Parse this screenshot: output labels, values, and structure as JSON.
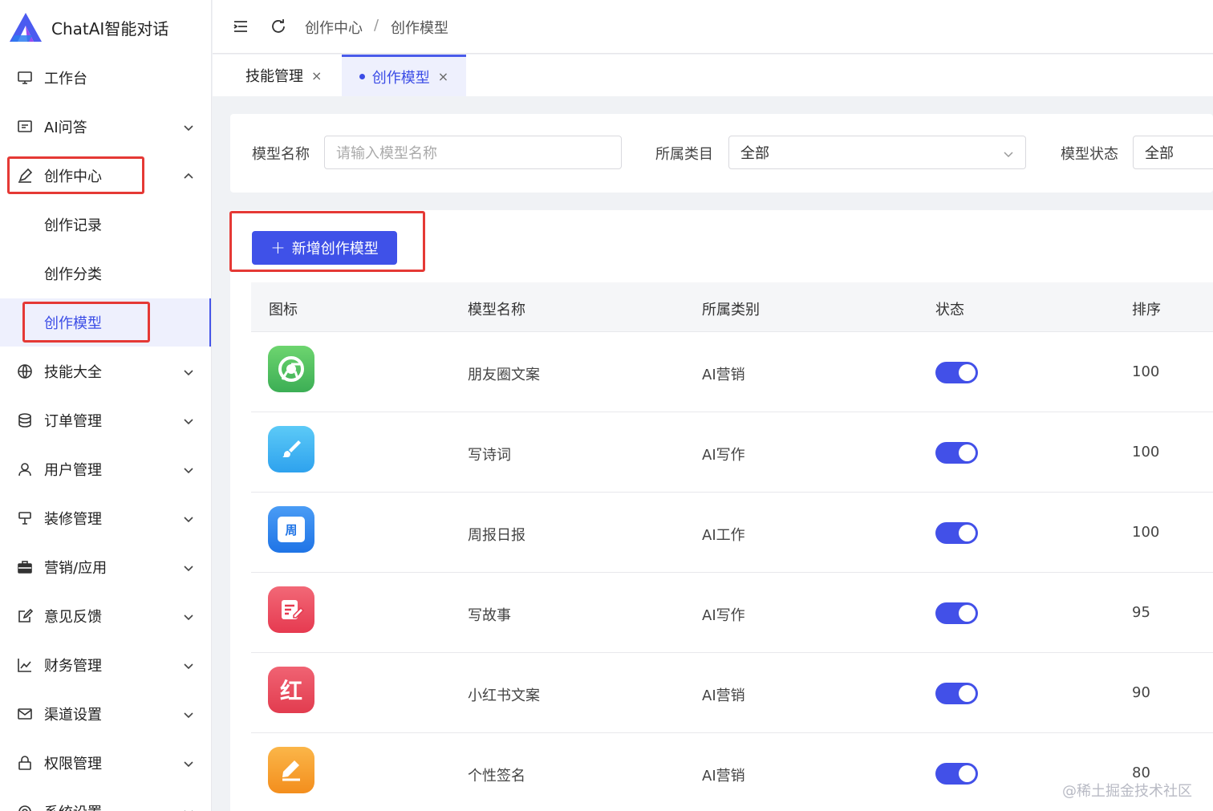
{
  "app": {
    "title": "ChatAI智能对话"
  },
  "sidebar": {
    "items": [
      {
        "label": "工作台",
        "icon": "monitor-icon"
      },
      {
        "label": "AI问答",
        "icon": "message-icon"
      },
      {
        "label": "创作中心",
        "icon": "edit-pen-icon"
      },
      {
        "label": "创作记录"
      },
      {
        "label": "创作分类"
      },
      {
        "label": "创作模型"
      },
      {
        "label": "技能大全",
        "icon": "globe-icon"
      },
      {
        "label": "订单管理",
        "icon": "database-icon"
      },
      {
        "label": "用户管理",
        "icon": "user-icon"
      },
      {
        "label": "装修管理",
        "icon": "brush-icon"
      },
      {
        "label": "营销/应用",
        "icon": "briefcase-icon"
      },
      {
        "label": "意见反馈",
        "icon": "feedback-icon"
      },
      {
        "label": "财务管理",
        "icon": "chart-icon"
      },
      {
        "label": "渠道设置",
        "icon": "mail-icon"
      },
      {
        "label": "权限管理",
        "icon": "lock-icon"
      },
      {
        "label": "系统设置",
        "icon": "settings-icon"
      }
    ]
  },
  "header": {
    "breadcrumb": [
      "创作中心",
      "创作模型"
    ],
    "separator": "/"
  },
  "tabs": [
    {
      "label": "技能管理",
      "close": "×"
    },
    {
      "label": "创作模型",
      "close": "×"
    }
  ],
  "filters": {
    "name_label": "模型名称",
    "name_placeholder": "请输入模型名称",
    "category_label": "所属类目",
    "category_value": "全部",
    "status_label": "模型状态",
    "status_value": "全部"
  },
  "toolbar": {
    "add_label": "新增创作模型",
    "add_icon": "+"
  },
  "table": {
    "headers": [
      "图标",
      "模型名称",
      "所属类别",
      "状态",
      "排序"
    ],
    "rows": [
      {
        "icon": "chrome-icon",
        "color": "#4cc26a",
        "name": "朋友圈文案",
        "category": "AI营销",
        "status": true,
        "sort": "100"
      },
      {
        "icon": "brush-icon",
        "color": "#3fb4f2",
        "name": "写诗词",
        "category": "AI写作",
        "status": true,
        "sort": "100"
      },
      {
        "icon": "calendar-icon",
        "color": "#2f86f0",
        "name": "周报日报",
        "category": "AI工作",
        "status": true,
        "sort": "100",
        "glyph": "周"
      },
      {
        "icon": "note-edit-icon",
        "color": "#ee4b5e",
        "name": "写故事",
        "category": "AI写作",
        "status": true,
        "sort": "95"
      },
      {
        "icon": "xiaohongshu-icon",
        "color": "#ec4b5a",
        "name": "小红书文案",
        "category": "AI营销",
        "status": true,
        "sort": "90",
        "glyph": "红"
      },
      {
        "icon": "pen-icon",
        "color": "#f7a22c",
        "name": "个性签名",
        "category": "AI营销",
        "status": true,
        "sort": "80"
      }
    ]
  },
  "watermark": "@稀土掘金技术社区",
  "colors": {
    "primary": "#3f51e8",
    "highlight": "#e53935",
    "active_bg": "#eef0fd"
  }
}
